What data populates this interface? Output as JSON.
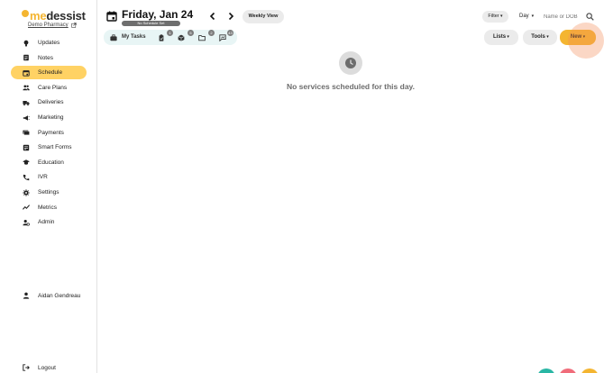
{
  "app": {
    "logo_me": "me",
    "logo_rest": "dessist",
    "pharmacy": "Demo Pharmacy",
    "brand_color": "#f4b531"
  },
  "sidebar": {
    "items": [
      {
        "label": "Updates",
        "icon": "lightbulb-icon"
      },
      {
        "label": "Notes",
        "icon": "notes-icon"
      },
      {
        "label": "Schedule",
        "icon": "calendar-icon",
        "active": true
      },
      {
        "label": "Care Plans",
        "icon": "people-icon"
      },
      {
        "label": "Deliveries",
        "icon": "truck-icon"
      },
      {
        "label": "Marketing",
        "icon": "megaphone-icon"
      },
      {
        "label": "Payments",
        "icon": "payments-icon"
      },
      {
        "label": "Smart Forms",
        "icon": "forms-icon"
      },
      {
        "label": "Education",
        "icon": "graduation-cap-icon"
      },
      {
        "label": "IVR",
        "icon": "phone-icon"
      },
      {
        "label": "Settings",
        "icon": "gear-icon"
      },
      {
        "label": "Metrics",
        "icon": "chart-line-icon"
      },
      {
        "label": "Admin",
        "icon": "admin-icon"
      }
    ],
    "user": "Aidan Gendreau",
    "logout": "Logout"
  },
  "header": {
    "date_title": "Friday, Jan 24",
    "no_schedule_badge": "No Schedule Set",
    "weekly_view": "Weekly View",
    "filter": "Filter",
    "day_select": "Day",
    "search_placeholder": "Name or DOB"
  },
  "tasks_bar": {
    "label": "My Tasks",
    "badges": [
      "1",
      "5",
      "2",
      "43"
    ]
  },
  "actions": {
    "lists": "Lists",
    "tools": "Tools",
    "new": "New"
  },
  "main": {
    "empty_message": "No services scheduled for this day."
  }
}
